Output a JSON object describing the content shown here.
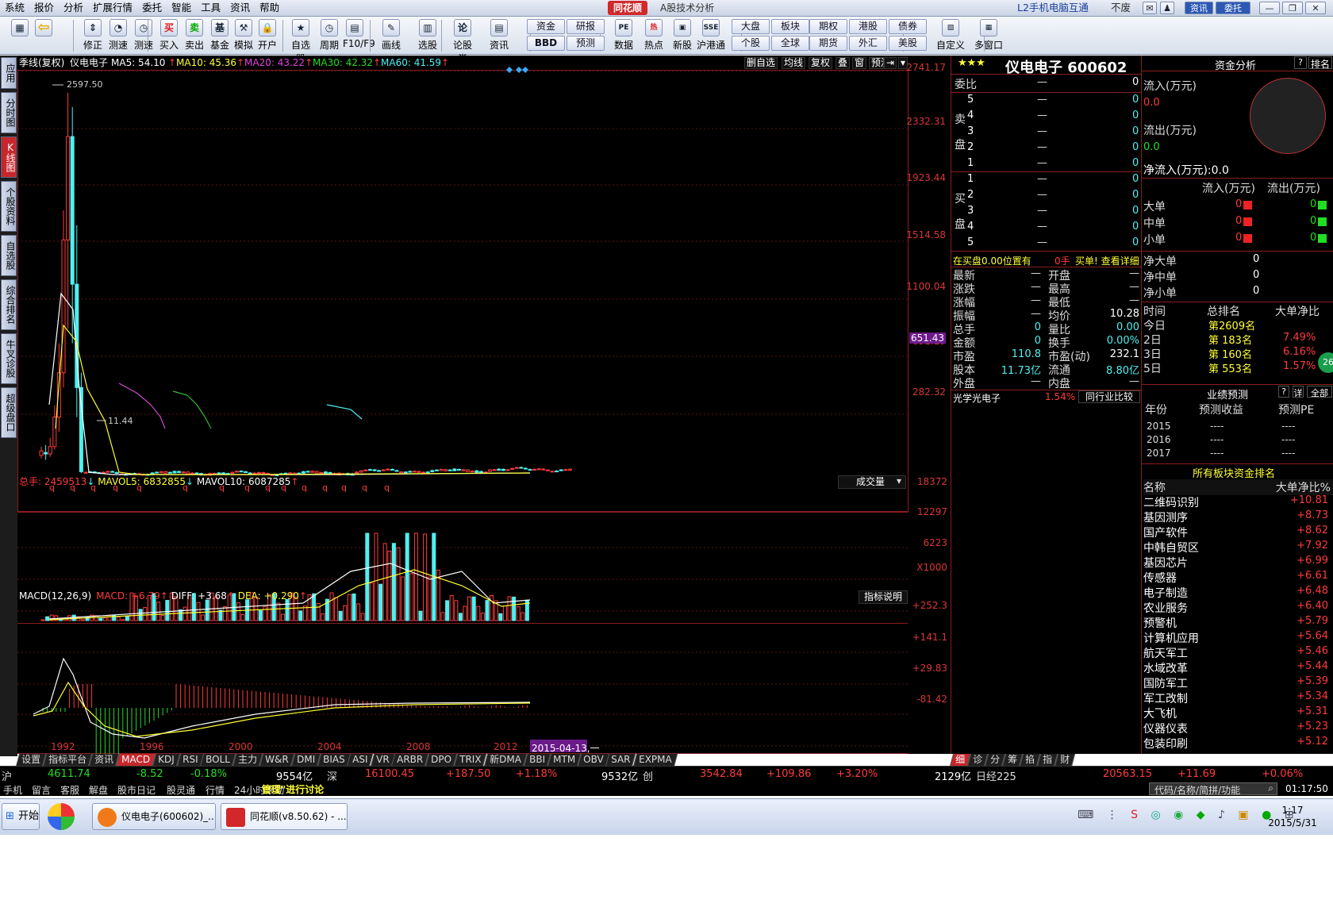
{
  "menubar": {
    "items": [
      "系统",
      "报价",
      "分析",
      "扩展行情",
      "委托",
      "智能",
      "工具",
      "资讯",
      "帮助"
    ],
    "app_logo": "同花顺",
    "app_subtitle": "A股技术分析",
    "l2_link": "L2手机电脑互通",
    "notice": "不废",
    "news_btn": "资讯",
    "trade_btn": "委托"
  },
  "toolbar": {
    "buttons": [
      {
        "label": "",
        "icon": "multicolor-grid-icon"
      },
      {
        "label": "",
        "icon": "back-arrow-icon"
      },
      {
        "label": "修正",
        "icon": "up-down-arrows-icon"
      },
      {
        "label": "测速",
        "icon": "speed-test-icon"
      },
      {
        "label": "测速",
        "icon": "clock-icon"
      },
      {
        "label": "买入",
        "icon": "buy-icon"
      },
      {
        "label": "卖出",
        "icon": "sell-icon"
      },
      {
        "label": "基金",
        "icon": "fund-icon"
      },
      {
        "label": "模拟",
        "icon": "hammer-icon"
      },
      {
        "label": "开户",
        "icon": "lock-icon"
      },
      {
        "label": "自选股",
        "icon": "star-icon"
      },
      {
        "label": "周期",
        "icon": "clock-icon"
      },
      {
        "label": "F10/F9",
        "icon": "f10-icon"
      },
      {
        "label": "画线",
        "icon": "pencil-icon"
      },
      {
        "label": "选股",
        "icon": "select-stock-icon"
      },
      {
        "label": "论股堂",
        "icon": "discussion-icon"
      },
      {
        "label": "资讯",
        "icon": "document-icon"
      }
    ],
    "small_buttons": [
      "资金",
      "BBD",
      "研报",
      "预测",
      "大盘",
      "个股",
      "板块",
      "全球",
      "期权",
      "期货",
      "港股",
      "外汇",
      "债券",
      "美股"
    ],
    "buttons2": [
      {
        "label": "数据",
        "icon": "pe-icon"
      },
      {
        "label": "热点",
        "icon": "hot-icon"
      },
      {
        "label": "新股",
        "icon": "new-stock-icon"
      },
      {
        "label": "沪港通",
        "icon": "hk-connect-icon"
      },
      {
        "label": "自定义",
        "icon": "custom-icon"
      },
      {
        "label": "多窗口",
        "icon": "multi-window-icon"
      }
    ]
  },
  "left_tabs": [
    "应用",
    "分时图",
    "K线图",
    "个股资料",
    "自选股",
    "综合排名",
    "牛叉诊股",
    "超级盘口"
  ],
  "chart": {
    "header": {
      "period": "季线(复权)",
      "stock_name": "仪电电子",
      "ma5": "MA5: 54.10",
      "ma10": "MA10: 45.36",
      "ma20": "MA20: 43.22",
      "ma30": "MA30: 42.32",
      "ma60": "MA60: 41.59"
    },
    "top_buttons": [
      "删自选",
      "均线",
      "复权",
      "叠",
      "窗",
      "预测"
    ],
    "price_axis": [
      "2741.17",
      "2332.31",
      "1923.44",
      "1514.58",
      "1100.04",
      "691.19",
      "282.32"
    ],
    "current_price_tag": "651.43",
    "high_marker": "2597.50",
    "low_marker": "11.44",
    "q_markers": "q",
    "volume_header": {
      "label": "总手: 2459513",
      "mavol5": "MAVOL5: 6832855",
      "mavol10": "MAVOL10: 6087285"
    },
    "volume_dropdown": "成交量",
    "volume_axis": [
      "18372",
      "12297",
      "6223",
      "X1000"
    ],
    "macd_header": {
      "label": "MACD(12,26,9)",
      "macd": "MACD: +6.79",
      "diff": "DIFF: +3.68",
      "dea": "DEA: +0.290"
    },
    "indicator_help": "指标说明",
    "macd_axis": [
      "+252.3",
      "+141.1",
      "+29.83",
      "-81.42"
    ],
    "x_axis": [
      "1992",
      "1996",
      "2000",
      "2004",
      "2008",
      "2012"
    ],
    "cursor_date": "2015-04-13,一",
    "bottom_tabs": [
      "设置",
      "指标平台",
      "资讯",
      "MACD",
      "KDJ",
      "RSI",
      "BOLL",
      "主力",
      "W&R",
      "DMI",
      "BIAS",
      "ASI",
      "VR",
      "ARBR",
      "DPO",
      "TRIX",
      "新DMA",
      "BBI",
      "MTM",
      "OBV",
      "SAR",
      "EXPMA"
    ],
    "active_tab": "MACD"
  },
  "chart_data": [
    {
      "type": "line",
      "title": "季线(复权) 仪电电子",
      "x": [
        "1992",
        "1996",
        "2000",
        "2004",
        "2008",
        "2012"
      ],
      "series_note": "quarterly candles; price approx",
      "series": [
        {
          "name": "price",
          "values": [
            150,
            2597.5,
            120,
            40,
            30,
            35,
            60,
            80,
            60,
            90
          ]
        }
      ],
      "ylim": [
        0,
        2741.17
      ]
    }
  ],
  "quote": {
    "title": "仪电电子 600602",
    "weibi_label": "委比",
    "dash": "—",
    "zero": "0",
    "sell_label": [
      "卖",
      "盘"
    ],
    "buy_label": [
      "买",
      "盘"
    ],
    "levels": [
      "5",
      "4",
      "3",
      "2",
      "1"
    ],
    "blevels": [
      "1",
      "2",
      "3",
      "4",
      "5"
    ],
    "promo_left": "在买盘0.00位置有",
    "promo_mid": "0手",
    "promo_right": "买单! 查看详细",
    "stats": [
      {
        "l": "最新",
        "v": "—",
        "l2": "开盘",
        "v2": "—"
      },
      {
        "l": "涨跌",
        "v": "—",
        "l2": "最高",
        "v2": "—"
      },
      {
        "l": "涨幅",
        "v": "—",
        "l2": "最低",
        "v2": "—"
      },
      {
        "l": "振幅",
        "v": "—",
        "l2": "均价",
        "v2": "10.28"
      },
      {
        "l": "总手",
        "v": "0",
        "l2": "量比",
        "v2": "0.00"
      },
      {
        "l": "金额",
        "v": "0",
        "l2": "换手",
        "v2": "0.00%"
      },
      {
        "l": "市盈",
        "v": "110.8",
        "l2": "市盈(动)",
        "v2": "232.1"
      },
      {
        "l": "股本",
        "v": "11.73亿",
        "l2": "流通",
        "v2": "8.80亿"
      },
      {
        "l": "外盘",
        "v": "—",
        "l2": "内盘",
        "v2": "—"
      }
    ],
    "industry": "光学光电子",
    "industry_pct": "1.54%",
    "compare_btn": "同行业比较",
    "bottom_tabs": [
      "细",
      "诊",
      "分",
      "筹",
      "掐",
      "指",
      "财"
    ]
  },
  "fund": {
    "title": "资金分析",
    "help": "?",
    "rank_btn": "排名",
    "inflow_label": "流入(万元)",
    "inflow_val": "0.0",
    "outflow_label": "流出(万元)",
    "outflow_val": "0.0",
    "netflow": "净流入(万元):0.0",
    "col_in": "流入(万元)",
    "col_out": "流出(万元)",
    "rows": [
      {
        "l": "大单",
        "in": "0",
        "out": "0"
      },
      {
        "l": "中单",
        "in": "0",
        "out": "0"
      },
      {
        "l": "小单",
        "in": "0",
        "out": "0"
      }
    ],
    "net_rows": [
      {
        "l": "净大单",
        "v": "0"
      },
      {
        "l": "净中单",
        "v": "0"
      },
      {
        "l": "净小单",
        "v": "0"
      }
    ],
    "rank_head": [
      "时间",
      "总排名",
      "大单净比"
    ],
    "rank_rows": [
      {
        "t": "今日",
        "r": "第2609名",
        "p": ""
      },
      {
        "t": "2日",
        "r": "第 183名",
        "p": "7.49%"
      },
      {
        "t": "3日",
        "r": "第 160名",
        "p": "6.16%"
      },
      {
        "t": "5日",
        "r": "第 553名",
        "p": "1.57%"
      }
    ],
    "badge": "26",
    "forecast_title": "业绩预测",
    "forecast_detail": "详",
    "forecast_all": "全部",
    "forecast_head": [
      "年份",
      "预测收益",
      "预测PE"
    ],
    "forecast_rows": [
      {
        "y": "2015",
        "e": "----",
        "pe": "----"
      },
      {
        "y": "2016",
        "e": "----",
        "pe": "----"
      },
      {
        "y": "2017",
        "e": "----",
        "pe": "----"
      }
    ],
    "sector_title": "所有板块资金排名",
    "sector_head": [
      "名称",
      "大单净比%"
    ],
    "sectors": [
      {
        "n": "二维码识别",
        "v": "+10.81"
      },
      {
        "n": "基因测序",
        "v": "+8.73"
      },
      {
        "n": "国产软件",
        "v": "+8.62"
      },
      {
        "n": "中韩自贸区",
        "v": "+7.92"
      },
      {
        "n": "基因芯片",
        "v": "+6.99"
      },
      {
        "n": "传感器",
        "v": "+6.61"
      },
      {
        "n": "电子制造",
        "v": "+6.48"
      },
      {
        "n": "农业服务",
        "v": "+6.40"
      },
      {
        "n": "预警机",
        "v": "+5.79"
      },
      {
        "n": "计算机应用",
        "v": "+5.64"
      },
      {
        "n": "航天军工",
        "v": "+5.46"
      },
      {
        "n": "水域改革",
        "v": "+5.44"
      },
      {
        "n": "国防军工",
        "v": "+5.39"
      },
      {
        "n": "军工改制",
        "v": "+5.34"
      },
      {
        "n": "大飞机",
        "v": "+5.31"
      },
      {
        "n": "仪器仪表",
        "v": "+5.23"
      },
      {
        "n": "包装印刷",
        "v": "+5.12"
      }
    ]
  },
  "statusbar": {
    "sh_label": "沪",
    "sh_val": "4611.74",
    "sh_chg": "-8.52",
    "sh_pct": "-0.18%",
    "sh_amt": "9554亿",
    "sz_label": "深",
    "sz_val": "16100.45",
    "sz_chg": "+187.50",
    "sz_pct": "+1.18%",
    "sz_amt": "9532亿",
    "cy_label": "创",
    "cy_val": "3542.84",
    "cy_chg": "+109.86",
    "cy_pct": "+3.20%",
    "cy_amt": "2129亿",
    "nk_label": "日经225",
    "nk_val": "20563.15",
    "nk_chg": "+11.69",
    "nk_pct": "+0.06%"
  },
  "statusbar2": {
    "items": [
      "手机",
      "留言",
      "客服",
      "解盘",
      "股市日记",
      "股灵通",
      "行情",
      "24小时滚动"
    ],
    "ticker": "管理\"进行讨论",
    "search_placeholder": "代码/名称/简拼/功能",
    "time": "01:17:50"
  },
  "taskbar": {
    "start": "开始",
    "task1": "仪电电子(600602)_...",
    "task2": "同花顺(v8.50.62) - ...",
    "clock_time": "1:17",
    "clock_date": "2015/5/31"
  }
}
